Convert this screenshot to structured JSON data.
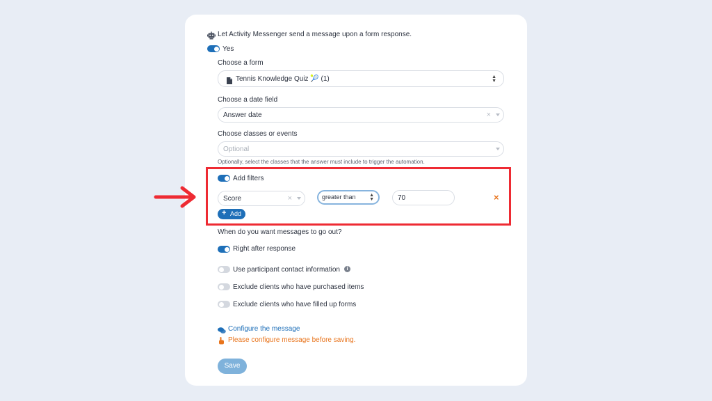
{
  "header": {
    "intro": "Let Activity Messenger send a message upon a form response.",
    "yes_label": "Yes"
  },
  "form": {
    "label": "Choose a form",
    "value": "Tennis Knowledge Quiz 🎾 (1)"
  },
  "date_field": {
    "label": "Choose a date field",
    "value": "Answer date"
  },
  "classes": {
    "label": "Choose classes or events",
    "placeholder": "Optional",
    "help": "Optionally, select the classes that the answer must include to trigger the automation."
  },
  "filters": {
    "label": "Add filters",
    "field": "Score",
    "operator": "greater than",
    "value": "70",
    "remove": "×",
    "add_label": "Add"
  },
  "timing": {
    "question": "When do you want messages to go out?",
    "right_after": "Right after response",
    "use_contact": "Use participant contact information",
    "exclude_purchased": "Exclude clients who have purchased items",
    "exclude_forms": "Exclude clients who have filled up forms"
  },
  "message": {
    "configure_link": "Configure the message",
    "warning": "Please configure message before saving."
  },
  "save_label": "Save",
  "colors": {
    "accent": "#1e6fb8",
    "highlight": "#ee2b33",
    "warning": "#e8741c"
  }
}
